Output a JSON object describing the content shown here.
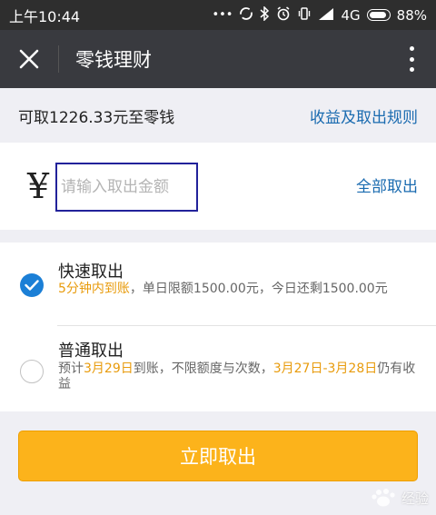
{
  "status_bar": {
    "time": "上午10:44",
    "network": "4G",
    "battery_percent": "88%",
    "icons": [
      "more-dots-icon",
      "sync-icon",
      "bluetooth-icon",
      "alarm-icon",
      "vibrate-icon",
      "signal-icon",
      "battery-icon"
    ]
  },
  "header": {
    "title": "零钱理财",
    "close_icon": "close-icon",
    "more_icon": "more-vertical-icon"
  },
  "balance": {
    "text": "可取1226.33元至零钱",
    "rules_link": "收益及取出规则"
  },
  "amount": {
    "currency_symbol": "¥",
    "placeholder": "请输入取出金额",
    "value": "",
    "all_link": "全部取出"
  },
  "options": {
    "fast": {
      "title": "快速取出",
      "selected": true,
      "desc_highlight": "5分钟内到账",
      "desc_rest": "，单日限额1500.00元，今日还剩1500.00元"
    },
    "normal": {
      "title": "普通取出",
      "selected": false,
      "desc_part1": "预计",
      "desc_date": "3月29日",
      "desc_part2": "到账，不限额度与次数，",
      "desc_range": "3月27日-3月28日",
      "desc_part3": "仍有收益"
    }
  },
  "submit": {
    "label": "立即取出"
  },
  "watermark": {
    "text": "经验"
  },
  "colors": {
    "title_bar": "#393a3f",
    "status_bar": "#2e2e2e",
    "link": "#1a6bb0",
    "highlight": "#e89b0c",
    "button": "#fcb31b",
    "radio_checked": "#1b7fd6"
  }
}
